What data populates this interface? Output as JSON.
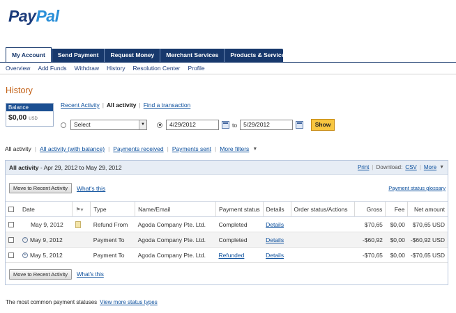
{
  "logo": {
    "pay": "Pay",
    "pal": "Pal"
  },
  "tabs": [
    "My Account",
    "Send Payment",
    "Request Money",
    "Merchant Services",
    "Products & Services"
  ],
  "subnav": [
    "Overview",
    "Add Funds",
    "Withdraw",
    "History",
    "Resolution Center",
    "Profile"
  ],
  "history_title": "History",
  "balance": {
    "label": "Balance",
    "amount": "$0,00",
    "currency": "USD"
  },
  "view_tabs": {
    "recent": "Recent Activity",
    "all": "All activity",
    "find": "Find a transaction"
  },
  "filter": {
    "select_value": "Select",
    "date_from": "4/29/2012",
    "to_label": "to",
    "date_to": "5/29/2012",
    "show_label": "Show"
  },
  "filter_tabs": [
    "All activity",
    "All activity (with balance)",
    "Payments received",
    "Payments sent",
    "More filters"
  ],
  "panel": {
    "title_bold": "All activity",
    "title_range": " - Apr 29, 2012 to May 29, 2012",
    "print": "Print",
    "download_label": "Download:",
    "csv": "CSV",
    "more": "More",
    "move_btn": "Move to Recent Activity",
    "whats_this": "What's this",
    "glossary": "Payment status glossary"
  },
  "table": {
    "headers": {
      "date": "Date",
      "type": "Type",
      "name": "Name/Email",
      "status": "Payment status",
      "details": "Details",
      "order": "Order status/Actions",
      "gross": "Gross",
      "fee": "Fee",
      "net": "Net amount"
    },
    "rows": [
      {
        "date": "May 9, 2012",
        "type": "Refund From",
        "name": "Agoda Company Pte. Ltd.",
        "status": "Completed",
        "details": "Details",
        "gross": "$70,65",
        "fee": "$0,00",
        "net": "$70,65 USD"
      },
      {
        "date": "May 9, 2012",
        "type": "Payment To",
        "name": "Agoda Company Pte. Ltd.",
        "status": "Completed",
        "details": "Details",
        "gross": "-$60,92",
        "fee": "$0,00",
        "net": "-$60,92 USD"
      },
      {
        "date": "May 5, 2012",
        "type": "Payment To",
        "name": "Agoda Company Pte. Ltd.",
        "status": "Refunded",
        "details": "Details",
        "gross": "-$70,65",
        "fee": "$0,00",
        "net": "-$70,65 USD"
      }
    ]
  },
  "footer": {
    "text": "The most common payment statuses",
    "link": "View more status types"
  },
  "icons": {
    "calendar": "calendar-icon",
    "note": "note-icon",
    "flag": "flag-icon",
    "expand": "plus-icon"
  }
}
